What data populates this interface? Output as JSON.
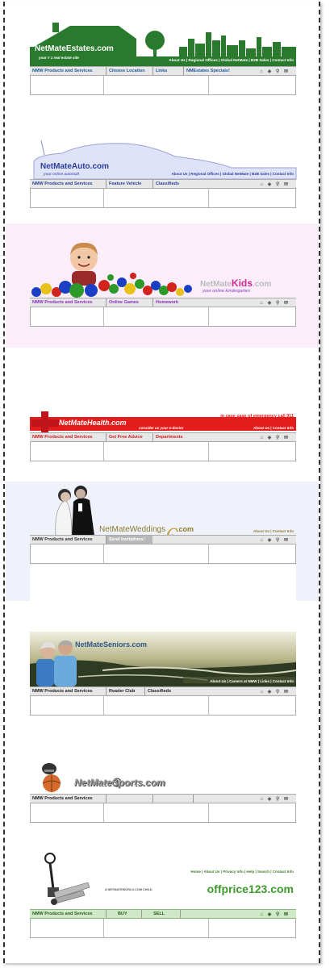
{
  "estates": {
    "logo": "NetMateEstates.com",
    "tagline": "your # 1 real estate site",
    "top_links": "About Us | Regional Offices | Global NetMate | B2B Sales | Contact Info",
    "nav": [
      "NMW Products and Services",
      "Choose Location",
      "Links",
      "NMEstates Specials!"
    ]
  },
  "auto": {
    "logo": "NetMateAuto.com",
    "tagline": "your online automall",
    "top_links": "About Us | Regional Offices | Global NetMate | B2B Sales | Contact Info",
    "nav": [
      "NMW Products and Services",
      "Feature Vehicle",
      "Classifieds"
    ]
  },
  "kids": {
    "logo_a": "NetMate",
    "logo_b": "Kids",
    "logo_c": ".com",
    "tagline": "your online kindergarten",
    "nav": [
      "NMW Products and Services",
      "Online Games",
      "Homework"
    ]
  },
  "health": {
    "logo": "NetMateHealth.com",
    "tagline": "consider us your e-doctor",
    "emergency": "in case case of emergency call 911",
    "top_links": "About Us | Contact Info",
    "nav": [
      "NMW Products and Services",
      "Get Free Advice",
      "Departments"
    ]
  },
  "weddings": {
    "logo": "NetMateWeddings",
    "logo_c": ".com",
    "top_links": "About Us | Contact Info",
    "nav": [
      "NMW Products and Services",
      "Send Invitations!"
    ]
  },
  "seniors": {
    "logo": "NetMateSeniors.com",
    "top_links": "About Us | Careers at NMW | Links | Contact Info",
    "nav": [
      "NMW Products and Services",
      "Reader Club",
      "Classifieds"
    ]
  },
  "sports": {
    "logo": "NetMateSports.com",
    "nav": [
      "NMW Products and Services",
      "",
      "",
      ""
    ]
  },
  "offprice": {
    "top_links": "Home | About Us | Privacy Info | Help | Search | Contact Info",
    "prefix": "A NETMATEWORLD.COM CHILD",
    "logo": "offprice123.com",
    "nav": [
      "NMW Products and Services",
      "BUY",
      "SELL"
    ]
  },
  "toolbar_icons": [
    "home-icon",
    "diamond-icon",
    "search-icon",
    "mail-icon"
  ],
  "colors": {
    "estates_green": "#2a7a2e",
    "auto_blue": "#2a3f9a",
    "kids_bg": "#fbeefa",
    "health_red": "#e41b1b",
    "weddings_bg": "#f0f2fb",
    "offprice_green": "#3f9a2e",
    "nav_gray": "#e7e7e7"
  }
}
